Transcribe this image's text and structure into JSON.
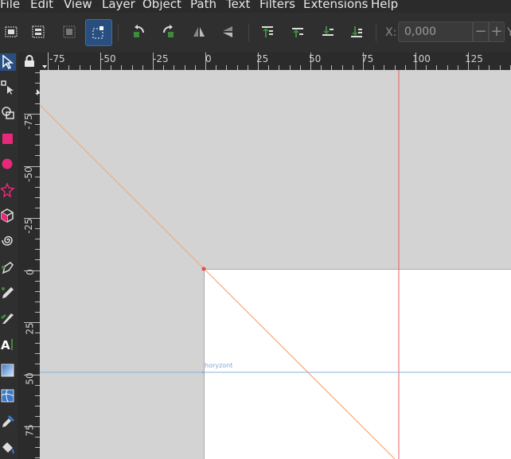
{
  "menu": [
    "File",
    "Edit",
    "View",
    "Layer",
    "Object",
    "Path",
    "Text",
    "Filters",
    "Extensions",
    "Help"
  ],
  "toolbar": {
    "buttons": [
      "select-all-icon",
      "select-all-layers-icon",
      "deselect-icon",
      "touch-select-icon",
      "rotate-ccw-icon",
      "rotate-cw-icon",
      "flip-horizontal-icon",
      "flip-vertical-icon",
      "raise-to-top-icon",
      "raise-icon",
      "lower-icon",
      "lower-to-bottom-icon"
    ],
    "x_label": "X:",
    "x_value": "0,000",
    "minus": "−",
    "plus": "+",
    "y_label": "Y"
  },
  "tools": [
    "selector-icon",
    "node-icon",
    "tweak-icon",
    "rectangle-icon",
    "ellipse-icon",
    "star-icon",
    "3d-box-icon",
    "spiral-icon",
    "pen-icon",
    "pencil-icon",
    "calligraphy-icon",
    "text-icon",
    "gradient-icon",
    "mesh-icon",
    "dropper-icon",
    "paint-bucket-icon"
  ],
  "ruler_top": [
    "-75",
    "-50",
    "-25",
    "0",
    "25",
    "50",
    "75",
    "100",
    "125"
  ],
  "ruler_left": [
    "-75",
    "-50",
    "-25",
    "0",
    "25",
    "50",
    "75"
  ],
  "canvas": {
    "guide_label": "horyzont"
  },
  "colors": {
    "accent": "#284f80",
    "page": "#ffffff",
    "desk": "#d3d3d3",
    "guide_orange": "#f0a070",
    "guide_red": "#e05050",
    "guide_blue": "#8ab4e0"
  }
}
